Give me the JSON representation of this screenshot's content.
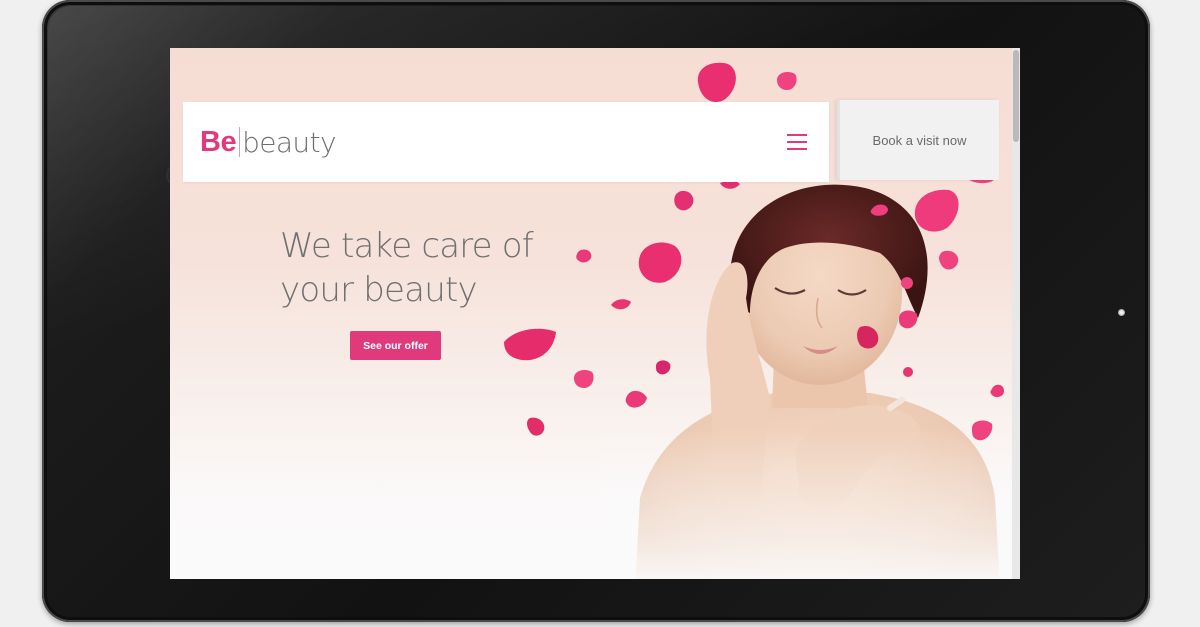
{
  "header": {
    "logo_be": "Be",
    "logo_beauty": "beauty",
    "menu_icon": "hamburger-menu-icon",
    "book_label": "Book a visit now"
  },
  "hero": {
    "headline_line1": "We take care of",
    "headline_line2": "your beauty",
    "cta_label": "See our offer"
  },
  "colors": {
    "accent": "#e03a7c",
    "petal": "#ec2b6e",
    "text": "#707070"
  }
}
